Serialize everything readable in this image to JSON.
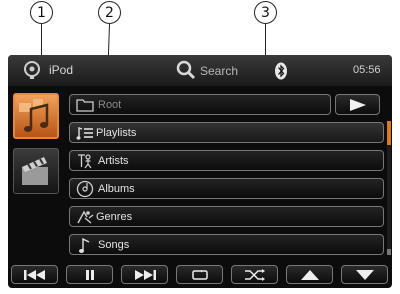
{
  "callouts": [
    "1",
    "2",
    "3"
  ],
  "header": {
    "source_label": "iPod",
    "source_icon": "ipod-icon",
    "search_label": "Search",
    "search_icon": "search-icon",
    "bluetooth_icon": "bluetooth-icon",
    "clock": "05:56"
  },
  "side_tiles": [
    {
      "name": "music-tile",
      "icon": "music-icon",
      "selected": true
    },
    {
      "name": "video-tile",
      "icon": "clapperboard-icon",
      "selected": false
    }
  ],
  "list": {
    "path": {
      "label": "Root",
      "icon": "folder-icon"
    },
    "items": [
      {
        "label": "Playlists",
        "icon": "playlist-icon"
      },
      {
        "label": "Artists",
        "icon": "artist-icon"
      },
      {
        "label": "Albums",
        "icon": "album-icon"
      },
      {
        "label": "Genres",
        "icon": "genres-icon"
      },
      {
        "label": "Songs",
        "icon": "note-icon"
      }
    ],
    "play_icon": "play-icon"
  },
  "controls": [
    "previous-icon",
    "pause-icon",
    "next-icon",
    "repeat-icon",
    "shuffle-icon",
    "up-icon",
    "down-icon"
  ],
  "colors": {
    "accent": "#d97920",
    "background": "#0c0c0c",
    "text": "#e4e4e4"
  }
}
